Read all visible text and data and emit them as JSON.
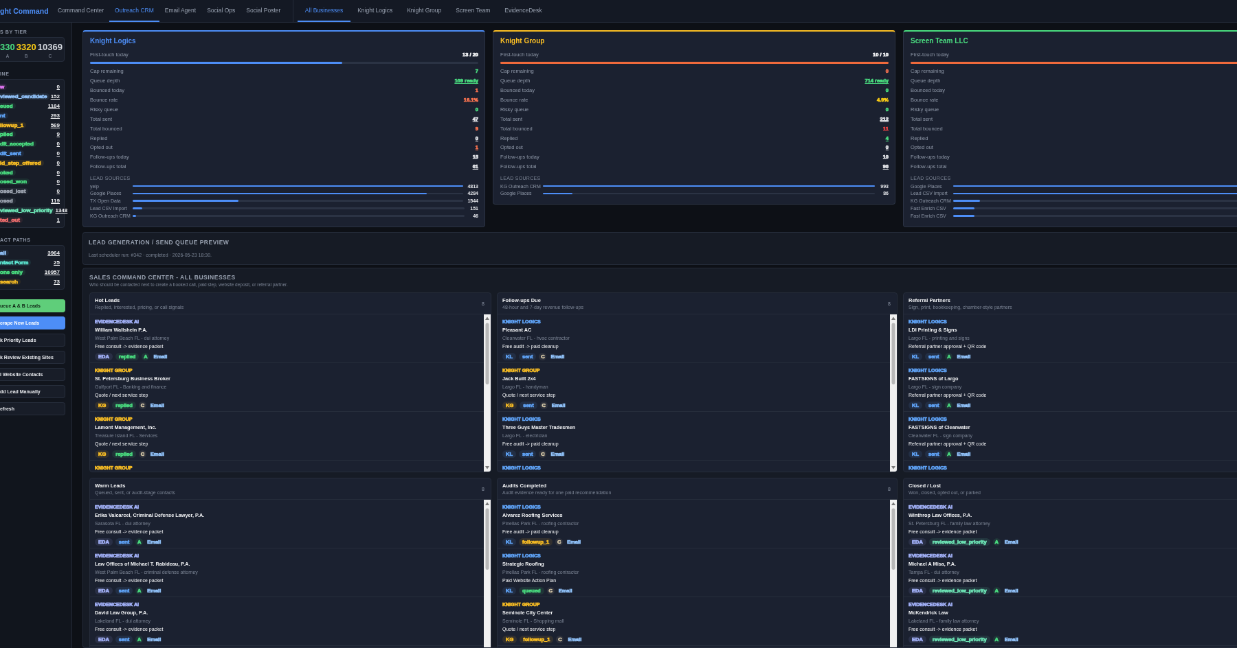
{
  "nav": {
    "brand": "ght Command",
    "app_tabs": [
      {
        "label": "Command Center",
        "selected": false
      },
      {
        "label": "Outreach CRM",
        "selected": true
      },
      {
        "label": "Email Agent",
        "selected": false
      },
      {
        "label": "Social Ops",
        "selected": false
      },
      {
        "label": "Social Poster",
        "selected": false
      }
    ],
    "business_tabs": [
      {
        "label": "All Businesses",
        "selected": true
      },
      {
        "label": "Knight Logics",
        "selected": false
      },
      {
        "label": "Knight Group",
        "selected": false
      },
      {
        "label": "Screen Team",
        "selected": false
      },
      {
        "label": "EvidenceDesk",
        "selected": false
      }
    ]
  },
  "sidebar": {
    "tiers": {
      "heading": "S BY TIER",
      "items": [
        {
          "value": "330",
          "label": "A",
          "color": "#4ade80"
        },
        {
          "value": "3320",
          "label": "B",
          "color": "#facc15"
        },
        {
          "value": "10369",
          "label": "C",
          "color": "#d1d5db"
        }
      ]
    },
    "pipeline": {
      "heading": "INE",
      "items": [
        {
          "label": "w",
          "count": "0",
          "color": "#e879f9"
        },
        {
          "label": "viewed_candidate",
          "count": "152",
          "color": "#93c5fd"
        },
        {
          "label": "eued",
          "count": "1184",
          "color": "#4ade80"
        },
        {
          "label": "nt",
          "count": "293",
          "color": "#60a5fa"
        },
        {
          "label": "llowup_1",
          "count": "569",
          "color": "#fbbf24"
        },
        {
          "label": "plied",
          "count": "9",
          "color": "#4ade80"
        },
        {
          "label": "dit_accepted",
          "count": "0",
          "color": "#4ade80"
        },
        {
          "label": "dit_sent",
          "count": "0",
          "color": "#60a5fa"
        },
        {
          "label": "id_step_offered",
          "count": "0",
          "color": "#fbbf24"
        },
        {
          "label": "oked",
          "count": "0",
          "color": "#4ade80"
        },
        {
          "label": "osed_won",
          "count": "0",
          "color": "#4ade80"
        },
        {
          "label": "osed_lost",
          "count": "0",
          "color": "#9ca3af"
        },
        {
          "label": "osed",
          "count": "119",
          "color": "#9ca3af"
        },
        {
          "label": "viewed_low_priority",
          "count": "1348",
          "color": "#6ee7b7"
        },
        {
          "label": "ted_out",
          "count": "1",
          "color": "#f87171"
        }
      ]
    },
    "contact_paths": {
      "heading": "ACT PATHS",
      "items": [
        {
          "label": "ail",
          "count": "3964",
          "color": "#93c5fd"
        },
        {
          "label": "ntact Form",
          "count": "25",
          "color": "#5eead4"
        },
        {
          "label": "one only",
          "count": "10957",
          "color": "#4ade80"
        },
        {
          "label": "search",
          "count": "73",
          "color": "#fbbf24"
        }
      ]
    },
    "buttons": [
      {
        "label": "ueue A & B Leads",
        "kind": "success"
      },
      {
        "label": "crape New Leads",
        "kind": "primary"
      },
      {
        "label": "k Priority Leads",
        "kind": "default"
      },
      {
        "label": "k Review Existing Sites",
        "kind": "default"
      },
      {
        "label": "l Website Contacts",
        "kind": "default"
      },
      {
        "label": "dd Lead Manually",
        "kind": "default"
      },
      {
        "label": "efresh",
        "kind": "default"
      }
    ]
  },
  "businesses": [
    {
      "name": "Knight Logics",
      "color": "#4d8ef7",
      "first_touch": {
        "label": "First-touch today",
        "value": "13 / 20",
        "level": 0.65
      },
      "stats": [
        {
          "label": "Cap remaining",
          "value": "7",
          "color": "#4ade80",
          "underlined": false
        },
        {
          "label": "Queue depth",
          "value": "169 ready",
          "color": "#4ade80",
          "underlined": true
        },
        {
          "label": "Bounced today",
          "value": "1",
          "color": "#f97350",
          "underlined": false
        },
        {
          "label": "Bounce rate",
          "value": "16.1%",
          "color": "#f97350",
          "underlined": false
        },
        {
          "label": "Risky queue",
          "value": "0",
          "color": "#4ade80",
          "underlined": false
        },
        {
          "label": "Total sent",
          "value": "47",
          "color": "#e5e7eb",
          "underlined": true
        },
        {
          "label": "Total bounced",
          "value": "9",
          "color": "#f97350",
          "underlined": false
        },
        {
          "label": "Replied",
          "value": "0",
          "color": "#e5e7eb",
          "underlined": true
        },
        {
          "label": "Opted out",
          "value": "1",
          "color": "#f97350",
          "underlined": true
        },
        {
          "label": "Follow-ups today",
          "value": "15",
          "color": "#e5e7eb",
          "underlined": false
        },
        {
          "label": "Follow-ups total",
          "value": "61",
          "color": "#e5e7eb",
          "underlined": true
        }
      ],
      "sources_heading": "LEAD SOURCES",
      "sources": [
        {
          "label": "yelp",
          "value": "4813",
          "level": 1
        },
        {
          "label": "Google Places",
          "value": "4284",
          "level": 0.89
        },
        {
          "label": "TX Open Data",
          "value": "1544",
          "level": 0.32
        },
        {
          "label": "Lead CSV Import",
          "value": "151",
          "level": 0.03
        },
        {
          "label": "KG Outreach CRM",
          "value": "46",
          "level": 0.01
        }
      ]
    },
    {
      "name": "Knight Group",
      "color": "#fbbf24",
      "first_touch": {
        "label": "First-touch today",
        "value": "10 / 10",
        "level": 1
      },
      "stats": [
        {
          "label": "Cap remaining",
          "value": "0",
          "color": "#f97350",
          "underlined": false
        },
        {
          "label": "Queue depth",
          "value": "714 ready",
          "color": "#4ade80",
          "underlined": true
        },
        {
          "label": "Bounced today",
          "value": "0",
          "color": "#4ade80",
          "underlined": false
        },
        {
          "label": "Bounce rate",
          "value": "4.9%",
          "color": "#facc15",
          "underlined": false
        },
        {
          "label": "Risky queue",
          "value": "0",
          "color": "#4ade80",
          "underlined": false
        },
        {
          "label": "Total sent",
          "value": "212",
          "color": "#e5e7eb",
          "underlined": true
        },
        {
          "label": "Total bounced",
          "value": "11",
          "color": "#ef4444",
          "underlined": false
        },
        {
          "label": "Replied",
          "value": "4",
          "color": "#4ade80",
          "underlined": true
        },
        {
          "label": "Opted out",
          "value": "0",
          "color": "#e5e7eb",
          "underlined": true
        },
        {
          "label": "Follow-ups today",
          "value": "10",
          "color": "#e5e7eb",
          "underlined": false
        },
        {
          "label": "Follow-ups total",
          "value": "96",
          "color": "#e5e7eb",
          "underlined": true
        }
      ],
      "sources_heading": "LEAD SOURCES",
      "sources": [
        {
          "label": "KG Outreach CRM",
          "value": "993",
          "level": 1
        },
        {
          "label": "Google Places",
          "value": "86",
          "level": 0.09
        }
      ]
    },
    {
      "name": "Screen Team LLC",
      "color": "#4ade80",
      "first_touch": {
        "label": "First-touch today",
        "level": 1
      },
      "stats": [
        {
          "label": "Cap remaining"
        },
        {
          "label": "Queue depth"
        },
        {
          "label": "Bounced today"
        },
        {
          "label": "Bounce rate"
        },
        {
          "label": "Risky queue"
        },
        {
          "label": "Total sent"
        },
        {
          "label": "Total bounced"
        },
        {
          "label": "Replied"
        },
        {
          "label": "Opted out"
        },
        {
          "label": "Follow-ups today"
        },
        {
          "label": "Follow-ups total"
        }
      ],
      "sources_heading": "LEAD SOURCES",
      "sources": [
        {
          "label": "Google Places",
          "level": 1
        },
        {
          "label": "Lead CSV Import",
          "level": 1
        },
        {
          "label": "KG Outreach CRM",
          "level": 0.09
        },
        {
          "label": "Fast Enrich CSV",
          "level": 0.07
        },
        {
          "label": "Fast Enrich CSV",
          "level": 0.07
        }
      ]
    }
  ],
  "lead_generation": {
    "title": "LEAD GENERATION / SEND QUEUE PREVIEW",
    "subtitle": "Last scheduler run: #342 · completed · 2026-05-23 18:30."
  },
  "sales": {
    "title": "SALES COMMAND CENTER - ALL BUSINESSES",
    "subtitle": "Who should be contacted next to create a booked call, paid step, website deposit, or referral partner.",
    "columns": [
      {
        "title": "Hot Leads",
        "subtitle": "Replied, interested, pricing, or call signals",
        "count": "8",
        "items": [
          {
            "business": "EVIDENCEDESK AI",
            "color": "#a5b4fc",
            "name": "William Wallshein P.A.",
            "location": "West Palm Beach FL - dui attorney",
            "offer": "Free consult -> evidence packet",
            "tags": [
              {
                "kind": "code",
                "text": "EDA",
                "color": "#a5b4fc"
              },
              {
                "kind": "status",
                "text": "replied",
                "color": "#4ade80"
              },
              {
                "kind": "tier",
                "text": "A",
                "color": "#4ade80"
              },
              {
                "kind": "channel",
                "text": "Email",
                "color": "#93c5fd"
              }
            ]
          },
          {
            "business": "KNIGHT GROUP",
            "color": "#fbbf24",
            "name": "St. Petersburg Business Broker",
            "location": "Gulfport FL - Banking and finance",
            "offer": "Quote / next service step",
            "tags": [
              {
                "kind": "code",
                "text": "KG",
                "color": "#fbbf24"
              },
              {
                "kind": "status",
                "text": "replied",
                "color": "#4ade80"
              },
              {
                "kind": "tier",
                "text": "C",
                "color": "#d6c9a8"
              },
              {
                "kind": "channel",
                "text": "Email",
                "color": "#93c5fd"
              }
            ]
          },
          {
            "business": "KNIGHT GROUP",
            "color": "#fbbf24",
            "name": "Lamont Management, Inc.",
            "location": "Treasure Island FL - Services",
            "offer": "Quote / next service step",
            "tags": [
              {
                "kind": "code",
                "text": "KG",
                "color": "#fbbf24"
              },
              {
                "kind": "status",
                "text": "replied",
                "color": "#4ade80"
              },
              {
                "kind": "tier",
                "text": "C",
                "color": "#d6c9a8"
              },
              {
                "kind": "channel",
                "text": "Email",
                "color": "#93c5fd"
              }
            ]
          },
          {
            "business": "KNIGHT GROUP",
            "color": "#fbbf24"
          }
        ]
      },
      {
        "title": "Follow-ups Due",
        "subtitle": "48-hour and 7-day revenue follow-ups",
        "count": "8",
        "items": [
          {
            "business": "KNIGHT LOGICS",
            "color": "#60a5fa",
            "name": "Pleasant AC",
            "location": "Clearwater FL - hvac contractor",
            "offer": "Free audit -> paid cleanup",
            "tags": [
              {
                "kind": "code",
                "text": "KL",
                "color": "#60a5fa"
              },
              {
                "kind": "status",
                "text": "sent",
                "color": "#60a5fa"
              },
              {
                "kind": "tier",
                "text": "C",
                "color": "#d6c9a8"
              },
              {
                "kind": "channel",
                "text": "Email",
                "color": "#93c5fd"
              }
            ]
          },
          {
            "business": "KNIGHT GROUP",
            "color": "#fbbf24",
            "name": "Jack Built 2x4",
            "location": "Largo FL - handyman",
            "offer": "Quote / next service step",
            "tags": [
              {
                "kind": "code",
                "text": "KG",
                "color": "#fbbf24"
              },
              {
                "kind": "status",
                "text": "sent",
                "color": "#60a5fa"
              },
              {
                "kind": "tier",
                "text": "C",
                "color": "#d6c9a8"
              },
              {
                "kind": "channel",
                "text": "Email",
                "color": "#93c5fd"
              }
            ]
          },
          {
            "business": "KNIGHT LOGICS",
            "color": "#60a5fa",
            "name": "Three Guys Master Tradesmen",
            "location": "Largo FL - electrician",
            "offer": "Free audit -> paid cleanup",
            "tags": [
              {
                "kind": "code",
                "text": "KL",
                "color": "#60a5fa"
              },
              {
                "kind": "status",
                "text": "sent",
                "color": "#60a5fa"
              },
              {
                "kind": "tier",
                "text": "C",
                "color": "#d6c9a8"
              },
              {
                "kind": "channel",
                "text": "Email",
                "color": "#93c5fd"
              }
            ]
          },
          {
            "business": "KNIGHT LOGICS",
            "color": "#60a5fa"
          }
        ]
      },
      {
        "title": "Referral Partners",
        "subtitle": "Sign, print, bookkeeping, chamber-style partners",
        "items": [
          {
            "business": "KNIGHT LOGICS",
            "color": "#60a5fa",
            "name": "LDI Printing & Signs",
            "location": "Largo FL - printing and signs",
            "offer": "Referral partner approval + QR code",
            "tags": [
              {
                "kind": "code",
                "text": "KL",
                "color": "#60a5fa"
              },
              {
                "kind": "status",
                "text": "sent",
                "color": "#60a5fa"
              },
              {
                "kind": "tier",
                "text": "A",
                "color": "#4ade80"
              },
              {
                "kind": "channel",
                "text": "Email",
                "color": "#93c5fd"
              }
            ]
          },
          {
            "business": "KNIGHT LOGICS",
            "color": "#60a5fa",
            "name": "FASTSIGNS of Largo",
            "location": "Largo FL - sign company",
            "offer": "Referral partner approval + QR code",
            "tags": [
              {
                "kind": "code",
                "text": "KL",
                "color": "#60a5fa"
              },
              {
                "kind": "status",
                "text": "sent",
                "color": "#60a5fa"
              },
              {
                "kind": "tier",
                "text": "A",
                "color": "#4ade80"
              },
              {
                "kind": "channel",
                "text": "Email",
                "color": "#93c5fd"
              }
            ]
          },
          {
            "business": "KNIGHT LOGICS",
            "color": "#60a5fa",
            "name": "FASTSIGNS of Clearwater",
            "location": "Clearwater FL - sign company",
            "offer": "Referral partner approval + QR code",
            "tags": [
              {
                "kind": "code",
                "text": "KL",
                "color": "#60a5fa"
              },
              {
                "kind": "status",
                "text": "sent",
                "color": "#60a5fa"
              },
              {
                "kind": "tier",
                "text": "A",
                "color": "#4ade80"
              },
              {
                "kind": "channel",
                "text": "Email",
                "color": "#93c5fd"
              }
            ]
          },
          {
            "business": "KNIGHT LOGICS",
            "color": "#60a5fa"
          }
        ]
      },
      {
        "title": "Warm Leads",
        "subtitle": "Queued, sent, or audit-stage contacts",
        "count": "8",
        "items": [
          {
            "business": "EVIDENCEDESK AI",
            "color": "#a5b4fc",
            "name": "Erika Valcarcel, Criminal Defense Lawyer, P.A.",
            "location": "Sarasota FL - dui attorney",
            "offer": "Free consult -> evidence packet",
            "tags": [
              {
                "kind": "code",
                "text": "EDA",
                "color": "#a5b4fc"
              },
              {
                "kind": "status",
                "text": "sent",
                "color": "#60a5fa"
              },
              {
                "kind": "tier",
                "text": "A",
                "color": "#4ade80"
              },
              {
                "kind": "channel",
                "text": "Email",
                "color": "#93c5fd"
              }
            ]
          },
          {
            "business": "EVIDENCEDESK AI",
            "color": "#a5b4fc",
            "name": "Law Offices of Michael T. Rabideau, P.A.",
            "location": "West Palm Beach FL - criminal defense attorney",
            "offer": "Free consult -> evidence packet",
            "tags": [
              {
                "kind": "code",
                "text": "EDA",
                "color": "#a5b4fc"
              },
              {
                "kind": "status",
                "text": "sent",
                "color": "#60a5fa"
              },
              {
                "kind": "tier",
                "text": "A",
                "color": "#4ade80"
              },
              {
                "kind": "channel",
                "text": "Email",
                "color": "#93c5fd"
              }
            ]
          },
          {
            "business": "EVIDENCEDESK AI",
            "color": "#a5b4fc",
            "name": "David Law Group, P.A.",
            "location": "Lakeland FL - dui attorney",
            "offer": "Free consult -> evidence packet",
            "tags": [
              {
                "kind": "code",
                "text": "EDA",
                "color": "#a5b4fc"
              },
              {
                "kind": "status",
                "text": "sent",
                "color": "#60a5fa"
              },
              {
                "kind": "tier",
                "text": "A",
                "color": "#4ade80"
              },
              {
                "kind": "channel",
                "text": "Email",
                "color": "#93c5fd"
              }
            ]
          }
        ]
      },
      {
        "title": "Audits Completed",
        "subtitle": "Audit evidence ready for one paid recommendation",
        "count": "8",
        "items": [
          {
            "business": "KNIGHT LOGICS",
            "color": "#60a5fa",
            "name": "Alvarez Roofing Services",
            "location": "Pinellas Park FL - roofing contractor",
            "offer": "Free audit -> paid cleanup",
            "tags": [
              {
                "kind": "code",
                "text": "KL",
                "color": "#60a5fa"
              },
              {
                "kind": "status",
                "text": "followup_1",
                "color": "#fbbf24"
              },
              {
                "kind": "tier",
                "text": "C",
                "color": "#d6c9a8"
              },
              {
                "kind": "channel",
                "text": "Email",
                "color": "#93c5fd"
              }
            ]
          },
          {
            "business": "KNIGHT LOGICS",
            "color": "#60a5fa",
            "name": "Strategic Roofing",
            "location": "Pinellas Park FL - roofing contractor",
            "offer": "Paid Website Action Plan",
            "tags": [
              {
                "kind": "code",
                "text": "KL",
                "color": "#60a5fa"
              },
              {
                "kind": "status",
                "text": "queued",
                "color": "#4ade80"
              },
              {
                "kind": "tier",
                "text": "C",
                "color": "#d6c9a8"
              },
              {
                "kind": "channel",
                "text": "Email",
                "color": "#93c5fd"
              }
            ]
          },
          {
            "business": "KNIGHT GROUP",
            "color": "#fbbf24",
            "name": "Seminole City Center",
            "location": "Seminole FL - Shopping mall",
            "offer": "Quote / next service step",
            "tags": [
              {
                "kind": "code",
                "text": "KG",
                "color": "#fbbf24"
              },
              {
                "kind": "status",
                "text": "followup_1",
                "color": "#fbbf24"
              },
              {
                "kind": "tier",
                "text": "C",
                "color": "#d6c9a8"
              },
              {
                "kind": "channel",
                "text": "Email",
                "color": "#93c5fd"
              }
            ]
          }
        ]
      },
      {
        "title": "Closed / Lost",
        "subtitle": "Won, closed, opted out, or parked",
        "items": [
          {
            "business": "EVIDENCEDESK AI",
            "color": "#a5b4fc",
            "name": "Winthrop Law Offices, P.A.",
            "location": "St. Petersburg FL - family law attorney",
            "offer": "Free consult -> evidence packet",
            "tags": [
              {
                "kind": "code",
                "text": "EDA",
                "color": "#a5b4fc"
              },
              {
                "kind": "status",
                "text": "reviewed_low_priority",
                "color": "#6ee7b7"
              },
              {
                "kind": "tier",
                "text": "A",
                "color": "#4ade80"
              },
              {
                "kind": "channel",
                "text": "Email",
                "color": "#93c5fd"
              }
            ]
          },
          {
            "business": "EVIDENCEDESK AI",
            "color": "#a5b4fc",
            "name": "Michael A Misa, P.A.",
            "location": "Tampa FL - dui attorney",
            "offer": "Free consult -> evidence packet",
            "tags": [
              {
                "kind": "code",
                "text": "EDA",
                "color": "#a5b4fc"
              },
              {
                "kind": "status",
                "text": "reviewed_low_priority",
                "color": "#6ee7b7"
              },
              {
                "kind": "tier",
                "text": "A",
                "color": "#4ade80"
              },
              {
                "kind": "channel",
                "text": "Email",
                "color": "#93c5fd"
              }
            ]
          },
          {
            "business": "EVIDENCEDESK AI",
            "color": "#a5b4fc",
            "name": "McKendrick Law",
            "location": "Lakeland FL - family law attorney",
            "offer": "Free consult -> evidence packet",
            "tags": [
              {
                "kind": "code",
                "text": "EDA",
                "color": "#a5b4fc"
              },
              {
                "kind": "status",
                "text": "reviewed_low_priority",
                "color": "#6ee7b7"
              },
              {
                "kind": "tier",
                "text": "A",
                "color": "#4ade80"
              },
              {
                "kind": "channel",
                "text": "Email",
                "color": "#93c5fd"
              }
            ]
          }
        ]
      }
    ]
  }
}
